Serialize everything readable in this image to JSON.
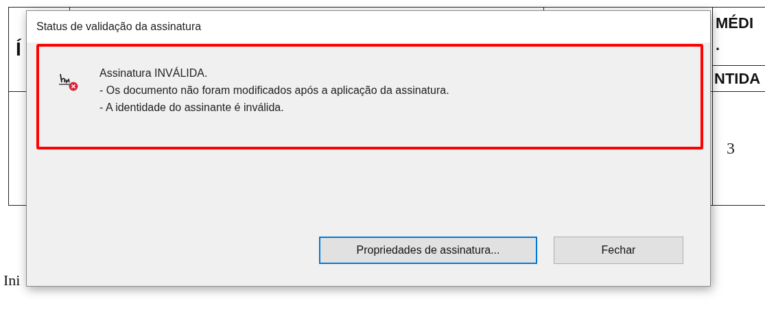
{
  "document": {
    "table": {
      "column_1_header": "Í",
      "column_4_header_lines": [
        "MÉDI",
        "."
      ],
      "column_4_subheader": "NTIDA",
      "rows": [
        {
          "column_4": "3"
        }
      ]
    },
    "text": "Ini"
  },
  "dialog": {
    "title": "Status de validação da assinatura",
    "message": {
      "heading": "Assinatura INVÁLIDA.",
      "lines": [
        "- Os documento não foram modificados após a aplicação da assinatura.",
        "- A identidade do assinante é inválida."
      ]
    },
    "buttons": [
      {
        "label": "Propriedades de assinatura...",
        "default": true
      },
      {
        "label": "Fechar",
        "default": false
      }
    ]
  }
}
